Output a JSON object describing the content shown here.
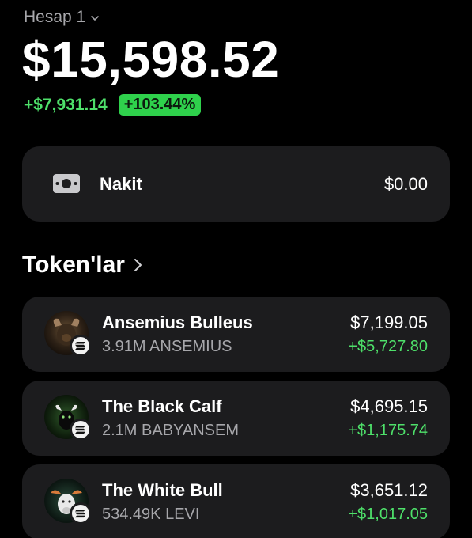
{
  "account": {
    "name": "Hesap 1"
  },
  "balance": "$15,598.52",
  "change": {
    "absolute": "+$7,931.14",
    "percent": "+103.44%"
  },
  "cash": {
    "label": "Nakit",
    "value": "$0.00",
    "icon": "cash-icon"
  },
  "tokens": {
    "title": "Token'lar",
    "items": [
      {
        "name": "Ansemius Bulleus",
        "qty": "3.91M ANSEMIUS",
        "value": "$7,199.05",
        "pnl": "+$5,727.80",
        "avatar": "ansemius-avatar"
      },
      {
        "name": "The Black Calf",
        "qty": "2.1M BABYANSEM",
        "value": "$4,695.15",
        "pnl": "+$1,175.74",
        "avatar": "black-calf-avatar"
      },
      {
        "name": "The White Bull",
        "qty": "534.49K LEVI",
        "value": "$3,651.12",
        "pnl": "+$1,017.05",
        "avatar": "white-bull-avatar"
      }
    ]
  },
  "colors": {
    "positive": "#4ee06a",
    "badge": "#2fd14c",
    "card": "#1c1c1e",
    "muted": "#a7a7ab"
  }
}
